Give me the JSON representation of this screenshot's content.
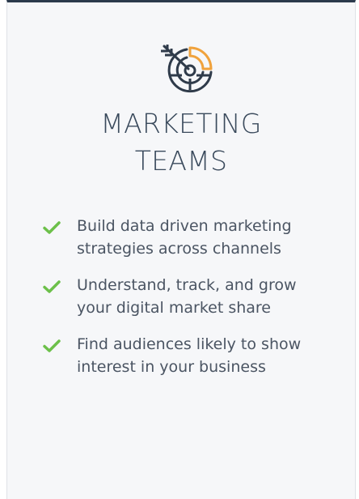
{
  "card": {
    "title_line1": "MARKETING",
    "title_line2": "TEAMS",
    "icon": "target-with-arrow-and-chart-icon",
    "accent_color": "#f0a23c",
    "check_color": "#6cc04a",
    "benefits": [
      {
        "line1": "Build data driven marketing",
        "line2": "strategies across channels"
      },
      {
        "line1": "Understand, track, and grow",
        "line2": "your digital market share"
      },
      {
        "line1": "Find audiences likely to show",
        "line2": "interest in your business"
      }
    ]
  }
}
